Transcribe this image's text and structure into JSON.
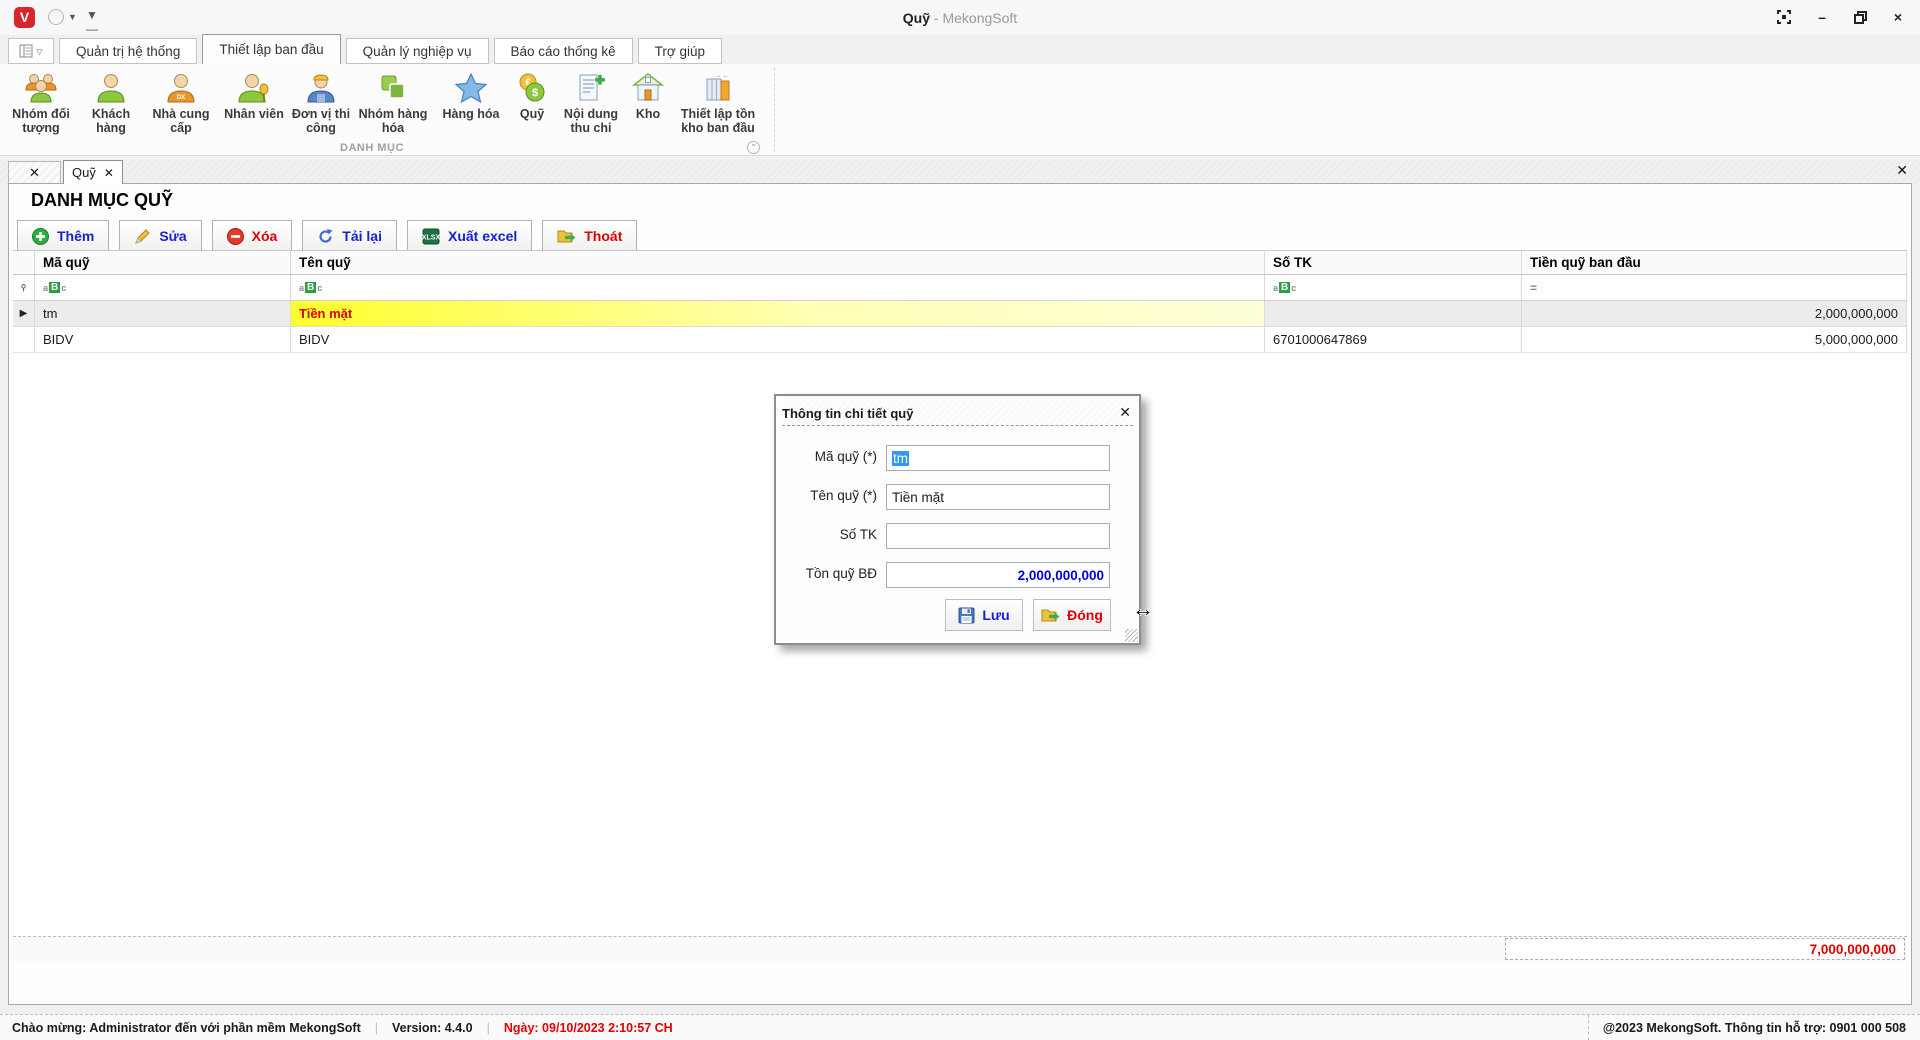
{
  "window": {
    "title": "Quỹ",
    "title_suffix": "- MekongSoft",
    "logo_letter": "V",
    "controls": {
      "minimize": "–",
      "close": "×"
    }
  },
  "menu": {
    "tabs": [
      {
        "label": "Quản trị hệ thống",
        "active": false
      },
      {
        "label": "Thiết lập ban đầu",
        "active": true
      },
      {
        "label": "Quản lý nghiệp vụ",
        "active": false
      },
      {
        "label": "Báo cáo thống kê",
        "active": false
      },
      {
        "label": "Trợ giúp",
        "active": false
      }
    ]
  },
  "ribbon": {
    "group_label": "DANH MỤC",
    "items": [
      {
        "label": "Nhóm đối tượng",
        "icon": "people-group-icon"
      },
      {
        "label": "Khách hàng",
        "icon": "customer-icon"
      },
      {
        "label": "Nhà cung cấp",
        "icon": "supplier-icon"
      },
      {
        "label": "Nhân viên",
        "icon": "employee-icon"
      },
      {
        "label": "Đơn vị thi công",
        "icon": "worker-icon"
      },
      {
        "label": "Nhóm hàng hóa",
        "icon": "product-group-icon"
      },
      {
        "label": "Hàng hóa",
        "icon": "star-icon"
      },
      {
        "label": "Quỹ",
        "icon": "coins-icon"
      },
      {
        "label": "Nội dung thu chi",
        "icon": "document-plus-icon"
      },
      {
        "label": "Kho",
        "icon": "warehouse-icon"
      },
      {
        "label": "Thiết lập tồn kho ban đầu",
        "icon": "stock-columns-icon"
      }
    ]
  },
  "tabstrip": {
    "close_all": "✕",
    "active_tab": "Quỹ",
    "tab_close": "✕",
    "strip_close": "✕"
  },
  "page": {
    "title": "DANH MỤC QUỸ",
    "toolbar": [
      {
        "label": "Thêm",
        "color": "blue",
        "icon": "plus-circle-icon"
      },
      {
        "label": "Sửa",
        "color": "blue",
        "icon": "pencil-icon"
      },
      {
        "label": "Xóa",
        "color": "red",
        "icon": "minus-circle-icon"
      },
      {
        "label": "Tải lại",
        "color": "blue",
        "icon": "refresh-icon"
      },
      {
        "label": "Xuất excel",
        "color": "blue",
        "icon": "excel-icon"
      },
      {
        "label": "Thoát",
        "color": "red",
        "icon": "exit-folder-icon"
      }
    ]
  },
  "grid": {
    "columns": [
      "Mã quỹ",
      "Tên quỹ",
      "Số TK",
      "Tiền quỹ ban đầu"
    ],
    "filter": {
      "text_icon_left": "a",
      "text_icon_mid": "B",
      "text_icon_right": "c",
      "numeric_icon": "="
    },
    "rows": [
      {
        "ma_quy": "tm",
        "ten_quy": "Tiền mặt",
        "so_tk": "",
        "tien_quy_ban_dau": "2,000,000,000",
        "selected": true,
        "highlighted": true
      },
      {
        "ma_quy": "BIDV",
        "ten_quy": "BIDV",
        "so_tk": "6701000647869",
        "tien_quy_ban_dau": "5,000,000,000",
        "selected": false,
        "highlighted": false
      }
    ],
    "footer_total": "7,000,000,000"
  },
  "dialog": {
    "title": "Thông tin chi tiết quỹ",
    "close": "✕",
    "fields": [
      {
        "label": "Mã quỹ (*)",
        "value": "tm",
        "text_selected": true
      },
      {
        "label": "Tên quỹ (*)",
        "value": "Tiền mặt",
        "text_selected": false
      },
      {
        "label": "Số TK",
        "value": "",
        "text_selected": false
      },
      {
        "label": "Tồn quỹ BĐ",
        "value": "2,000,000,000",
        "text_selected": false,
        "emphasized": true
      }
    ],
    "buttons": [
      {
        "label": "Lưu",
        "color": "blue",
        "icon": "save-icon"
      },
      {
        "label": "Đóng",
        "color": "red",
        "icon": "close-folder-icon"
      }
    ],
    "resize_cursor": "↔"
  },
  "statusbar": {
    "welcome": "Chào mừng: Administrator đến với phần mềm MekongSoft",
    "separator": "|",
    "version": "Version: 4.4.0",
    "date": "Ngày: 09/10/2023 2:10:57 CH",
    "copyright": "@2023 MekongSoft. Thông tin hỗ trợ: 0901 000 508"
  },
  "colors": {
    "accent_blue": "#1621d6",
    "accent_red": "#e00000",
    "highlight_yellow": "#ffff2e",
    "selection_blue": "#3297fd",
    "logo_red": "#d8262c"
  }
}
